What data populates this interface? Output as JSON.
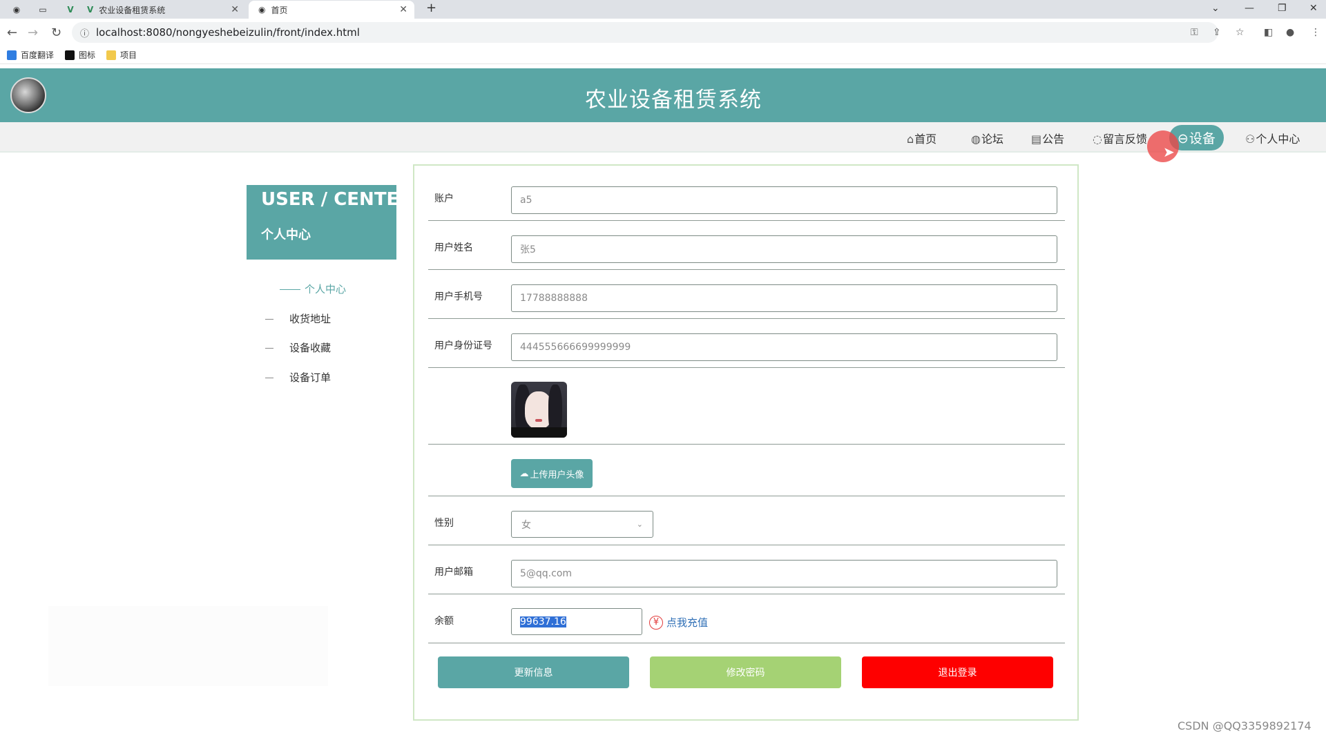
{
  "browser": {
    "tabs": [
      {
        "title": "农业设备租赁系统",
        "active": false
      },
      {
        "title": "首页",
        "active": true
      }
    ],
    "url": "localhost:8080/nongyeshebeizulin/front/index.html",
    "bookmarks": [
      "百度翻译",
      "图标",
      "项目"
    ]
  },
  "site": {
    "title": "农业设备租赁系统",
    "nav": [
      {
        "icon": "⌂",
        "label": "首页",
        "active": false
      },
      {
        "icon": "◍",
        "label": "论坛",
        "active": false
      },
      {
        "icon": "▤",
        "label": "公告",
        "active": false
      },
      {
        "icon": "◌",
        "label": "留言反馈",
        "active": false
      },
      {
        "icon": "⊖",
        "label": "设备",
        "active": true
      },
      {
        "icon": "⚇",
        "label": "个人中心",
        "active": false
      }
    ]
  },
  "sidebar": {
    "title_en": "USER / CENTER",
    "title_cn": "个人中心",
    "items": [
      {
        "label": "个人中心",
        "active": true
      },
      {
        "label": "收货地址",
        "active": false
      },
      {
        "label": "设备收藏",
        "active": false
      },
      {
        "label": "设备订单",
        "active": false
      }
    ]
  },
  "form": {
    "account_label": "账户",
    "account_value": "a5",
    "name_label": "用户姓名",
    "name_value": "张5",
    "phone_label": "用户手机号",
    "phone_value": "17788888888",
    "idcard_label": "用户身份证号",
    "idcard_value": "444555666699999999",
    "upload_label": "上传用户头像",
    "gender_label": "性别",
    "gender_value": "女",
    "email_label": "用户邮箱",
    "email_value": "5@qq.com",
    "balance_label": "余额",
    "balance_value": "99637.16",
    "recharge_label": "点我充值",
    "recharge_symbol": "¥"
  },
  "actions": {
    "update": "更新信息",
    "change_password": "修改密码",
    "logout": "退出登录"
  },
  "colors": {
    "primary": "#5aa6a5",
    "secondary": "#a5d274",
    "danger": "#fe0000"
  },
  "watermark": "CSDN @QQ3359892174"
}
